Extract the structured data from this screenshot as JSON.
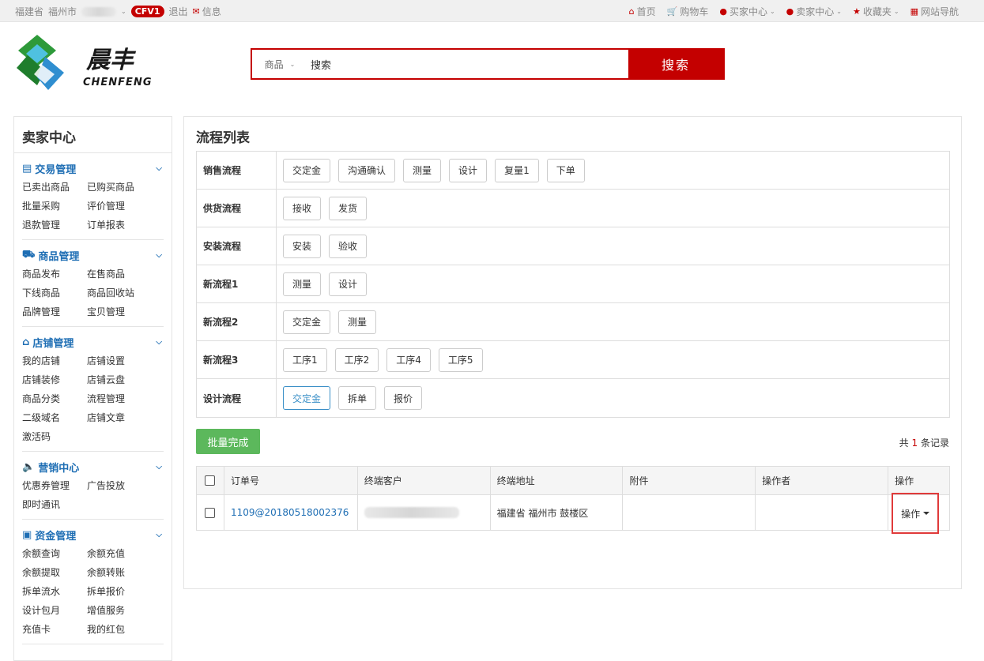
{
  "topbar": {
    "province": "福建省",
    "city": "福州市",
    "badge": "CFV1",
    "logout": "退出",
    "messages": "信息",
    "nav": [
      "首页",
      "购物车",
      "买家中心",
      "卖家中心",
      "收藏夹",
      "网站导航"
    ]
  },
  "header": {
    "logo_cn": "晨丰",
    "logo_en": "CHENFENG",
    "search_category": "商品",
    "search_value": "搜索",
    "search_button": "搜索"
  },
  "sidebar": {
    "title": "卖家中心",
    "sections": [
      {
        "title": "交易管理",
        "icon": "list-icon",
        "links": [
          "已卖出商品",
          "已购买商品",
          "批量采购",
          "评价管理",
          "退款管理",
          "订单报表"
        ]
      },
      {
        "title": "商品管理",
        "icon": "truck-icon",
        "links": [
          "商品发布",
          "在售商品",
          "下线商品",
          "商品回收站",
          "品牌管理",
          "宝贝管理"
        ]
      },
      {
        "title": "店铺管理",
        "icon": "home-icon",
        "links": [
          "我的店铺",
          "店铺设置",
          "店铺装修",
          "店铺云盘",
          "商品分类",
          "流程管理",
          "二级域名",
          "店铺文章",
          "激活码"
        ]
      },
      {
        "title": "营销中心",
        "icon": "speaker-icon",
        "links": [
          "优惠券管理",
          "广告投放",
          "即时通讯"
        ]
      },
      {
        "title": "资金管理",
        "icon": "money-icon",
        "links": [
          "余额查询",
          "余额充值",
          "余额提取",
          "余额转账",
          "拆单流水",
          "拆单报价",
          "设计包月",
          "增值服务",
          "充值卡",
          "我的红包"
        ]
      }
    ]
  },
  "main": {
    "title": "流程列表",
    "flows": [
      {
        "name": "销售流程",
        "steps": [
          "交定金",
          "沟通确认",
          "测量",
          "设计",
          "复量1",
          "下单"
        ]
      },
      {
        "name": "供货流程",
        "steps": [
          "接收",
          "发货"
        ]
      },
      {
        "name": "安装流程",
        "steps": [
          "安装",
          "验收"
        ]
      },
      {
        "name": "新流程1",
        "steps": [
          "测量",
          "设计"
        ]
      },
      {
        "name": "新流程2",
        "steps": [
          "交定金",
          "测量"
        ]
      },
      {
        "name": "新流程3",
        "steps": [
          "工序1",
          "工序2",
          "工序4",
          "工序5"
        ]
      },
      {
        "name": "设计流程",
        "steps": [
          "交定金",
          "拆单",
          "报价"
        ]
      }
    ],
    "batch_button": "批量完成",
    "count_prefix": "共",
    "count_value": "1",
    "count_suffix": "条记录",
    "table": {
      "headers": [
        "订单号",
        "终端客户",
        "终端地址",
        "附件",
        "操作者",
        "操作"
      ],
      "rows": [
        {
          "order": "1109@20180518002376",
          "customer": "",
          "address": "福建省 福州市 鼓楼区",
          "attachment": "",
          "operator": "",
          "action": "操作"
        }
      ]
    }
  },
  "colors": {
    "brand_red": "#c40000",
    "link_blue": "#1e6eb4",
    "green": "#5cb85c"
  }
}
